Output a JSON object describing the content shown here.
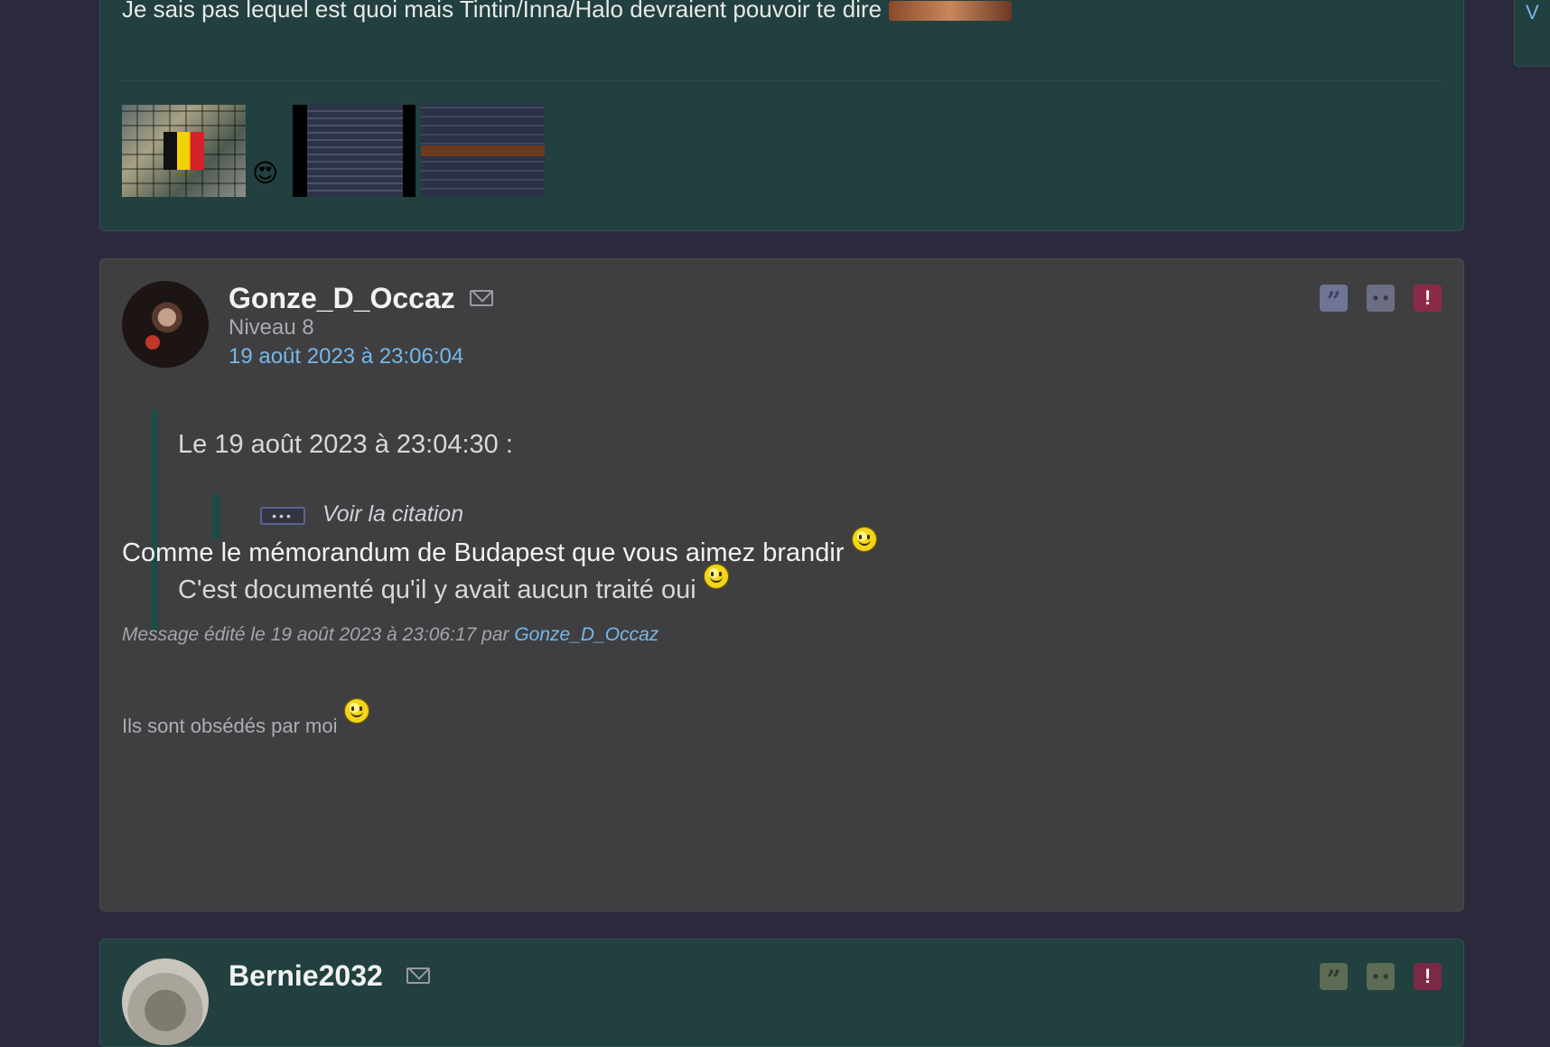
{
  "colors": {
    "page_background": "#2b2a3d",
    "post_highlight_background": "#21403f",
    "post_background": "#3f3f41",
    "link": "#76b8e8",
    "quote_bar": "#1e4a47",
    "report_button": "#8a2a47"
  },
  "previous_post": {
    "text": "Je sais pas lequel est quoi mais Tintin/Inna/Halo devraient pouvoir te dire",
    "inline_image_icon": "image-icon",
    "thumbnails": [
      {
        "icon": "image-thumbnail-icon"
      },
      {
        "icon": "image-thumbnail-icon"
      },
      {
        "icon": "image-thumbnail-icon"
      }
    ],
    "smiley": "in-love-smiley-icon"
  },
  "post": {
    "author": "Gonze_D_Occaz",
    "level": "Niveau 8",
    "date": "19 août 2023 à 23:06:04",
    "actions": {
      "quote_icon": "quote-icon",
      "quote_glyph": "”",
      "sad_icon": "sad-face-icon",
      "sad_glyph": "• •",
      "report_icon": "report-icon",
      "report_glyph": "!"
    },
    "quote": {
      "header": "Le 19 août 2023 à 23:04:30 :",
      "nested_ellipsis": "•••",
      "nested_label": "Voir la citation",
      "body": "C'est documenté qu'il y avait aucun traité oui"
    },
    "message": "Comme le mémorandum de Budapest que vous aimez brandir",
    "edit_note": {
      "prefix": "Message édité le 19 août 2023 à 23:06:17 par",
      "user": "Gonze_D_Occaz"
    },
    "signature": "Ils sont obsédés par moi"
  },
  "next_post": {
    "author": "Bernie2032"
  },
  "right_widget": {
    "label": "V"
  }
}
